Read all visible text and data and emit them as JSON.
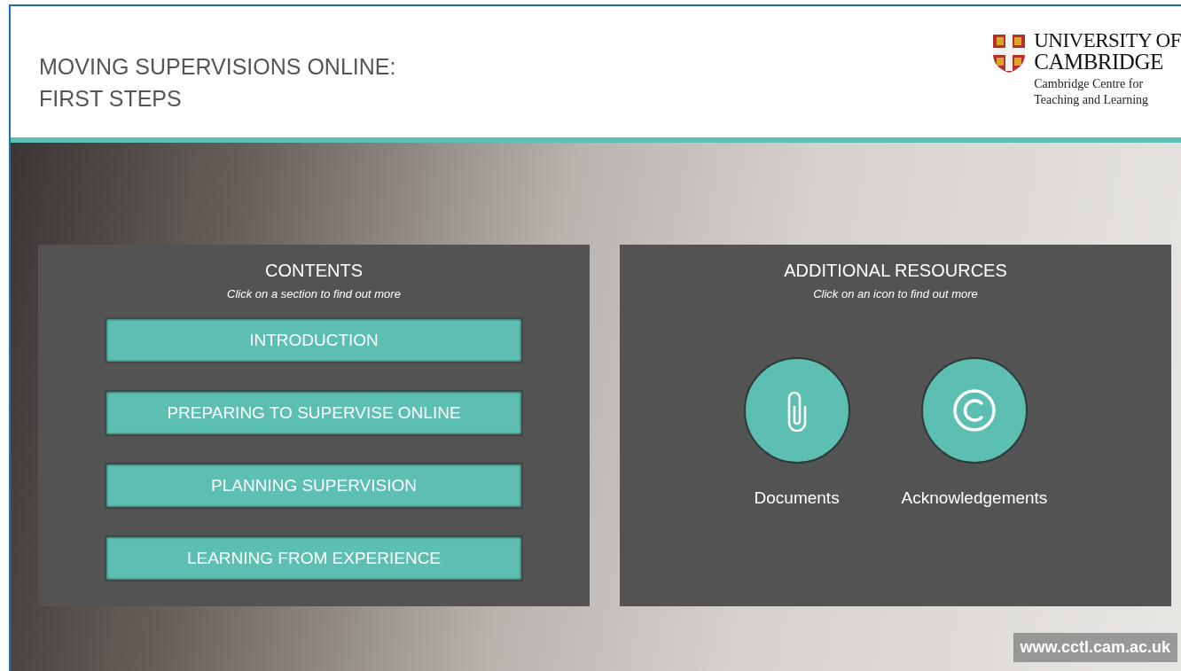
{
  "header": {
    "title_lines": [
      "MOVING SUPERVISIONS ONLINE:",
      "FIRST STEPS"
    ],
    "logo": {
      "name_lines": [
        "UNIVERSITY OF",
        "CAMBRIDGE"
      ],
      "subtitle_lines": [
        "Cambridge Centre for",
        "Teaching and Learning"
      ]
    }
  },
  "contents": {
    "title": "CONTENTS",
    "hint": "Click on a section to find out more",
    "sections": [
      {
        "label": "INTRODUCTION"
      },
      {
        "label": "PREPARING TO SUPERVISE ONLINE"
      },
      {
        "label": "PLANNING SUPERVISION"
      },
      {
        "label": "LEARNING FROM EXPERIENCE"
      }
    ]
  },
  "resources": {
    "title": "ADDITIONAL RESOURCES",
    "hint": "Click on an icon to find out more",
    "items": [
      {
        "label": "Documents",
        "kind": "paperclip"
      },
      {
        "label": "Acknowledgements",
        "kind": "copyright"
      }
    ]
  },
  "footer_url": "www.cctl.cam.ac.uk"
}
